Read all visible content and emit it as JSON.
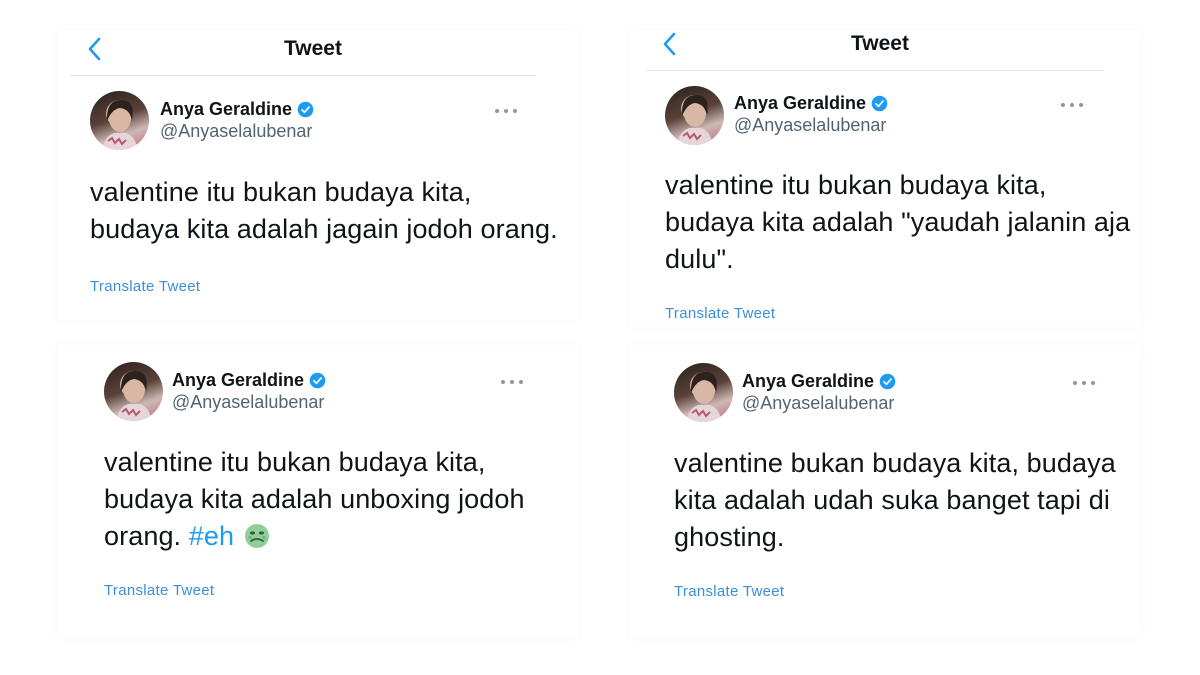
{
  "tweets": [
    {
      "header": {
        "title": "Tweet"
      },
      "author": {
        "name": "Anya Geraldine",
        "handle": "@Anyaselalubenar",
        "verified": true
      },
      "lines": [
        "valentine itu bukan budaya kita,",
        "budaya kita adalah jagain jodoh orang."
      ],
      "translate_label": "Translate Tweet"
    },
    {
      "header": {
        "title": "Tweet"
      },
      "author": {
        "name": "Anya Geraldine",
        "handle": "@Anyaselalubenar",
        "verified": true
      },
      "lines": [
        "valentine itu bukan budaya kita,",
        "budaya kita adalah \"yaudah jalanin aja",
        "dulu\"."
      ],
      "translate_label": "Translate Tweet"
    },
    {
      "author": {
        "name": "Anya Geraldine",
        "handle": "@Anyaselalubenar",
        "verified": true
      },
      "lines": [
        "valentine itu bukan budaya kita,",
        "budaya kita adalah unboxing jodoh",
        "orang."
      ],
      "hashtag": "#eh",
      "emoji": "nauseated-face-emoji",
      "translate_label": "Translate Tweet"
    },
    {
      "author": {
        "name": "Anya Geraldine",
        "handle": "@Anyaselalubenar",
        "verified": true
      },
      "lines": [
        "valentine bukan budaya kita, budaya",
        "kita adalah udah suka banget tapi di",
        "ghosting."
      ],
      "translate_label": "Translate Tweet"
    }
  ],
  "colors": {
    "accent": "#1d9bf0",
    "translate_link": "#3a8fd8",
    "text": "#0f1419",
    "secondary_text": "#536471"
  },
  "icons": [
    "chevron-left-icon",
    "verified-badge-icon",
    "more-options-icon"
  ]
}
